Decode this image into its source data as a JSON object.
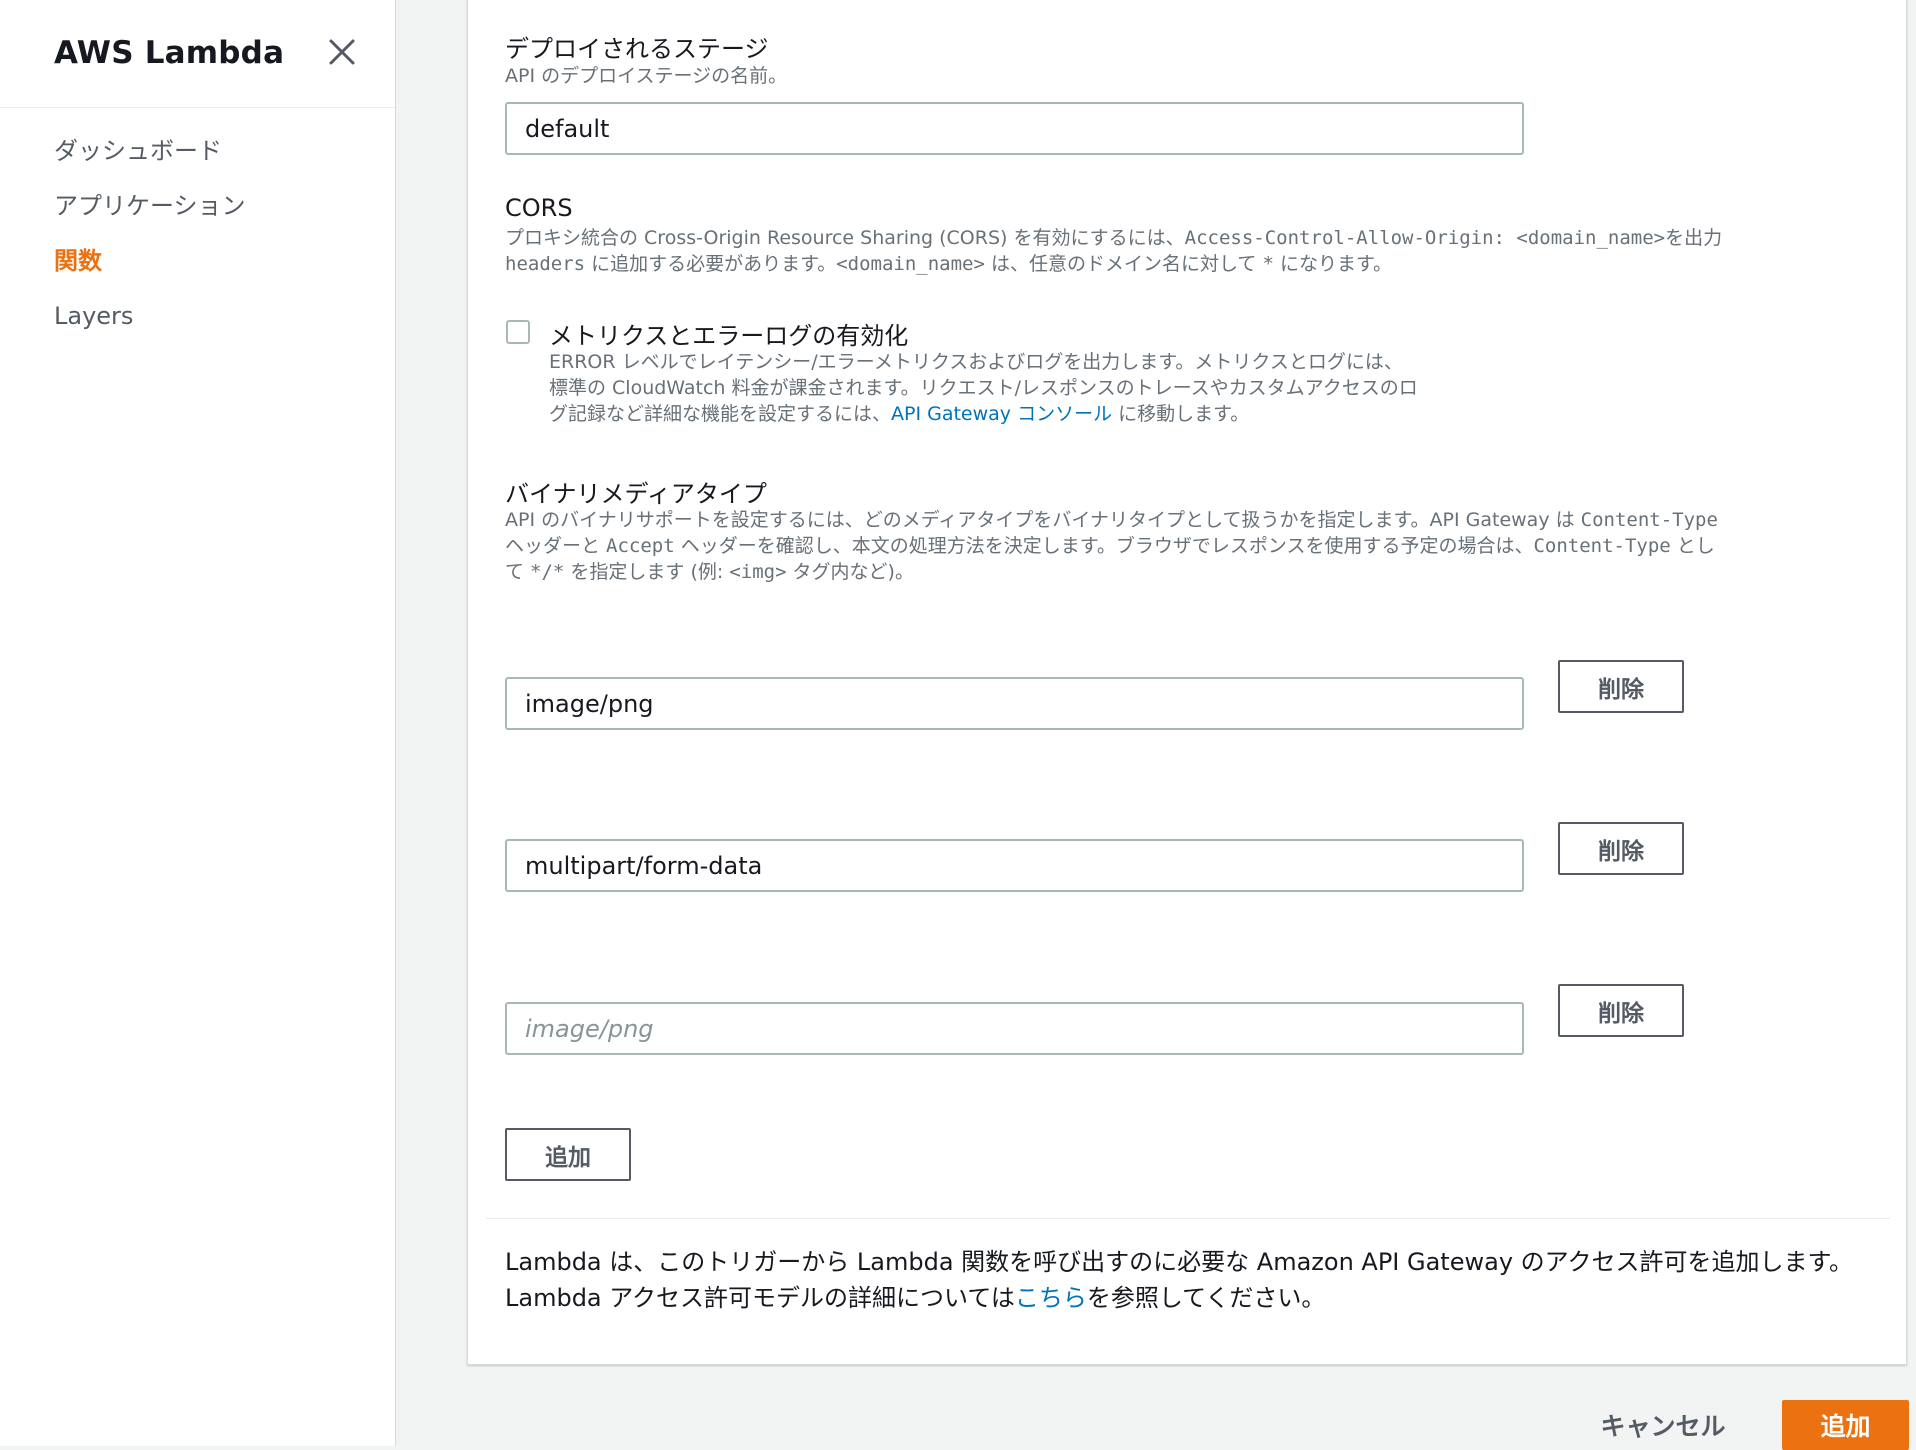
{
  "sidebar": {
    "title": "AWS Lambda",
    "close_icon": "close-icon",
    "items": [
      {
        "label": "ダッシュボード",
        "active": false
      },
      {
        "label": "アプリケーション",
        "active": false
      },
      {
        "label": "関数",
        "active": true
      },
      {
        "label": "Layers",
        "active": false
      }
    ]
  },
  "form": {
    "stage": {
      "label": "デプロイされるステージ",
      "description": "API のデプロイステージの名前。",
      "value": "default"
    },
    "cors": {
      "label": "CORS",
      "desc_line1_a": "プロキシ統合の Cross-Origin Resource Sharing (CORS) を有効にするには、",
      "desc_line1_code": "Access-Control-Allow-Origin: <domain_name>",
      "desc_line1_b": "を出力",
      "desc_line2_code": "headers",
      "desc_line2_a": " に追加する必要があります。",
      "desc_line2_code2": "<domain_name>",
      "desc_line2_b": " は、任意のドメイン名に対して ",
      "desc_line2_code3": "*",
      "desc_line2_c": " になります。"
    },
    "metrics": {
      "label": "メトリクスとエラーログの有効化",
      "checked": false,
      "desc_line1": "ERROR レベルでレイテンシー/エラーメトリクスおよびログを出力します。メトリクスとログには、",
      "desc_line2": "標準の CloudWatch 料金が課金されます。リクエスト/レスポンスのトレースやカスタムアクセスのロ",
      "desc_line3_a": "グ記録など詳細な機能を設定するには、",
      "desc_line3_link": "API Gateway コンソール",
      "desc_line3_b": " に移動します。"
    },
    "binary": {
      "label": "バイナリメディアタイプ",
      "desc_line1_a": "API のバイナリサポートを設定するには、どのメディアタイプをバイナリタイプとして扱うかを指定します。API Gateway は ",
      "desc_line1_code": "Content-Type",
      "desc_line2_a": "ヘッダーと ",
      "desc_line2_code": "Accept",
      "desc_line2_b": " ヘッダーを確認し、本文の処理方法を決定します。ブラウザでレスポンスを使用する予定の場合は、",
      "desc_line2_code2": "Content-Type",
      "desc_line2_c": " とし",
      "desc_line3_a": "て ",
      "desc_line3_code": "*/*",
      "desc_line3_b": " を指定します (例: ",
      "desc_line3_code2": "<img>",
      "desc_line3_c": " タグ内など)。",
      "types": [
        {
          "value": "image/png",
          "placeholder": ""
        },
        {
          "value": "multipart/form-data",
          "placeholder": ""
        },
        {
          "value": "",
          "placeholder": "image/png"
        }
      ],
      "remove_label": "削除",
      "add_label": "追加"
    },
    "footer_note": {
      "line1": "Lambda は、このトリガーから Lambda 関数を呼び出すのに必要な Amazon API Gateway のアクセス許可を追加します。",
      "line2_a": "Lambda アクセス許可モデルの詳細については",
      "line2_link": "こちら",
      "line2_b": "を参照してください。"
    }
  },
  "actions": {
    "cancel_label": "キャンセル",
    "submit_label": "追加"
  },
  "colors": {
    "accent": "#ec7211",
    "link": "#0073bb"
  }
}
